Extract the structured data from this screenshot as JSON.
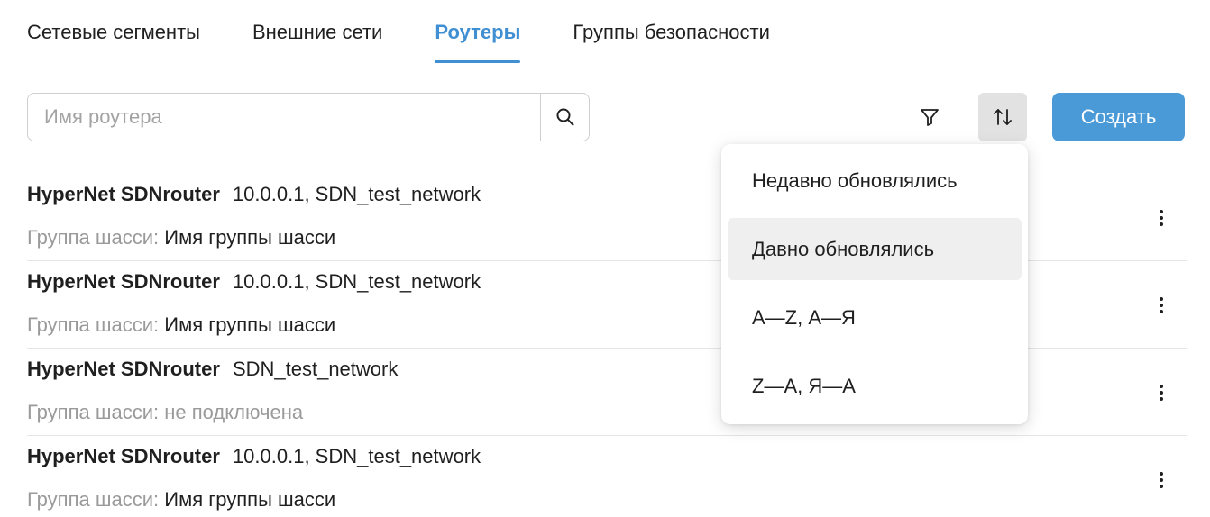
{
  "tabs": [
    {
      "label": "Сетевые сегменты"
    },
    {
      "label": "Внешние сети"
    },
    {
      "label": "Роутеры",
      "active": true
    },
    {
      "label": "Группы безопасности"
    }
  ],
  "search": {
    "placeholder": "Имя роутера",
    "value": ""
  },
  "toolbar": {
    "filter_icon": "filter-icon",
    "sort_icon": "sort-icon",
    "create_label": "Создать"
  },
  "routers": [
    {
      "name": "HyperNet SDNrouter",
      "networks": "10.0.0.1, SDN_test_network",
      "group_label": "Группа шасси:",
      "group_value": "Имя группы шасси"
    },
    {
      "name": "HyperNet SDNrouter",
      "networks": "10.0.0.1, SDN_test_network",
      "group_label": "Группа шасси:",
      "group_value": "Имя группы шасси"
    },
    {
      "name": "HyperNet SDNrouter",
      "networks": "SDN_test_network",
      "group_label": "Группа шасси:",
      "group_value": "не подключена"
    },
    {
      "name": "HyperNet SDNrouter",
      "networks": "10.0.0.1, SDN_test_network",
      "group_label": "Группа шасси:",
      "group_value": "Имя группы шасси"
    }
  ],
  "sort_menu": {
    "items": [
      {
        "label": "Недавно обновлялись"
      },
      {
        "label": "Давно обновлялись",
        "highlighted": true
      },
      {
        "label": "A—Z, А—Я"
      },
      {
        "label": "Z—A, Я—А"
      }
    ]
  },
  "colors": {
    "accent": "#3f8fd2",
    "primary_button": "#4a9ad8",
    "muted_text": "#9a9a9a"
  }
}
